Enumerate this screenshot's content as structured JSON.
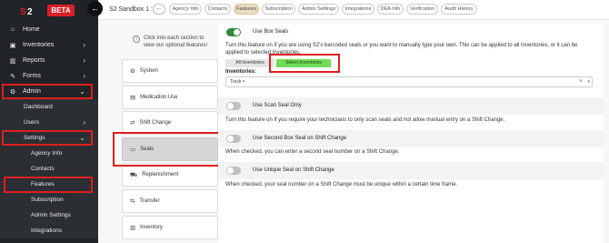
{
  "brand": {
    "beta": "BETA"
  },
  "sidebar": {
    "home": "Home",
    "inventories": "Inventories",
    "reports": "Reports",
    "forms": "Forms",
    "admin": "Admin",
    "dashboard": "Dashboard",
    "users": "Users",
    "settings": "Settings",
    "agency_info": "Agency Info",
    "contacts": "Contacts",
    "features": "Features",
    "subscription": "Subscription",
    "admin_settings": "Admin Settings",
    "integrations": "Integrations"
  },
  "topbar": {
    "breadcrumb": "S2 Sandbox 1 :",
    "tabs": [
      "Agency Info",
      "Contacts",
      "Features",
      "Subscription",
      "Admin Settings",
      "Integrations",
      "DEA Info",
      "Verification",
      "Audit History"
    ],
    "active_tab": "Features"
  },
  "features_list": {
    "hint": "Click into each section to view our optional features!",
    "items": [
      "System",
      "Medication Use",
      "Shift Change",
      "Seals",
      "Replenishment",
      "Transfer",
      "Inventory"
    ],
    "active": "Seals"
  },
  "settings": {
    "box_seals": {
      "title": "Use Box Seals",
      "enabled": true,
      "desc": "Turn this feature on if you are using S2's barcoded seals or you want to manually type your own. This can be applied to all Inventories, or it can be applied to selected Inventories.",
      "all_label": "All Inventories",
      "select_label": "Select Inventories",
      "inventories_label": "Inventories:",
      "inventories_value": "Truck"
    },
    "scan_only": {
      "title": "Use Scan Seal Only",
      "enabled": false,
      "desc": "Turn this feature on if you require your technicians to only scan seals and not allow manual entry on a Shift Change."
    },
    "second_box": {
      "title": "Use Second Box Seal on Shift Change",
      "enabled": false,
      "desc": "When checked, you can enter a second seal number on a Shift Change."
    },
    "unique_seal": {
      "title": "Use Unique Seal on Shift Change",
      "enabled": false,
      "desc": "When checked, your seal number on a Shift Change must be unique within a certain time frame."
    }
  },
  "colors": {
    "sidebar_bg": "#202327",
    "highlight": "#e01e1e",
    "toggle_on": "#2f8a3c",
    "select_green": "#6fdc57",
    "active_tab": "#e9dcc0"
  }
}
